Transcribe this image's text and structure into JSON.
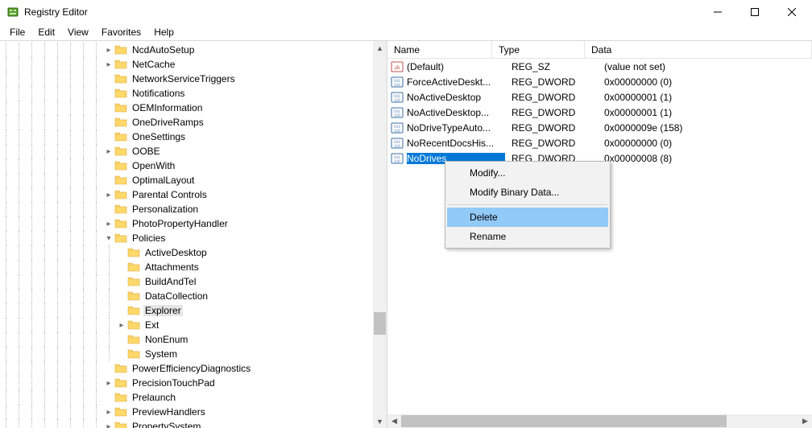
{
  "window": {
    "title": "Registry Editor"
  },
  "menubar": [
    "File",
    "Edit",
    "View",
    "Favorites",
    "Help"
  ],
  "tree": [
    {
      "depth": 8,
      "exp": "closed",
      "label": "NcdAutoSetup"
    },
    {
      "depth": 8,
      "exp": "closed",
      "label": "NetCache"
    },
    {
      "depth": 8,
      "exp": "none",
      "label": "NetworkServiceTriggers"
    },
    {
      "depth": 8,
      "exp": "none",
      "label": "Notifications"
    },
    {
      "depth": 8,
      "exp": "none",
      "label": "OEMInformation"
    },
    {
      "depth": 8,
      "exp": "none",
      "label": "OneDriveRamps"
    },
    {
      "depth": 8,
      "exp": "none",
      "label": "OneSettings"
    },
    {
      "depth": 8,
      "exp": "closed",
      "label": "OOBE"
    },
    {
      "depth": 8,
      "exp": "none",
      "label": "OpenWith"
    },
    {
      "depth": 8,
      "exp": "none",
      "label": "OptimalLayout"
    },
    {
      "depth": 8,
      "exp": "closed",
      "label": "Parental Controls"
    },
    {
      "depth": 8,
      "exp": "none",
      "label": "Personalization"
    },
    {
      "depth": 8,
      "exp": "closed",
      "label": "PhotoPropertyHandler"
    },
    {
      "depth": 8,
      "exp": "open",
      "label": "Policies"
    },
    {
      "depth": 9,
      "exp": "none",
      "label": "ActiveDesktop"
    },
    {
      "depth": 9,
      "exp": "none",
      "label": "Attachments"
    },
    {
      "depth": 9,
      "exp": "none",
      "label": "BuildAndTel"
    },
    {
      "depth": 9,
      "exp": "none",
      "label": "DataCollection"
    },
    {
      "depth": 9,
      "exp": "none",
      "label": "Explorer",
      "selected": true
    },
    {
      "depth": 9,
      "exp": "closed",
      "label": "Ext"
    },
    {
      "depth": 9,
      "exp": "none",
      "label": "NonEnum"
    },
    {
      "depth": 9,
      "exp": "none",
      "label": "System"
    },
    {
      "depth": 8,
      "exp": "none",
      "label": "PowerEfficiencyDiagnostics"
    },
    {
      "depth": 8,
      "exp": "closed",
      "label": "PrecisionTouchPad"
    },
    {
      "depth": 8,
      "exp": "none",
      "label": "Prelaunch"
    },
    {
      "depth": 8,
      "exp": "closed",
      "label": "PreviewHandlers"
    },
    {
      "depth": 8,
      "exp": "closed",
      "label": "PropertySystem"
    }
  ],
  "list": {
    "headers": {
      "name": "Name",
      "type": "Type",
      "data": "Data"
    },
    "rows": [
      {
        "icon": "sz",
        "name": "(Default)",
        "type": "REG_SZ",
        "data": "(value not set)"
      },
      {
        "icon": "dword",
        "name": "ForceActiveDeskt...",
        "type": "REG_DWORD",
        "data": "0x00000000 (0)"
      },
      {
        "icon": "dword",
        "name": "NoActiveDesktop",
        "type": "REG_DWORD",
        "data": "0x00000001 (1)"
      },
      {
        "icon": "dword",
        "name": "NoActiveDesktop...",
        "type": "REG_DWORD",
        "data": "0x00000001 (1)"
      },
      {
        "icon": "dword",
        "name": "NoDriveTypeAuto...",
        "type": "REG_DWORD",
        "data": "0x0000009e (158)"
      },
      {
        "icon": "dword",
        "name": "NoRecentDocsHis...",
        "type": "REG_DWORD",
        "data": "0x00000000 (0)"
      },
      {
        "icon": "dword",
        "name": "NoDrives",
        "type": "REG_DWORD",
        "data": "0x00000008 (8)",
        "selected": true
      }
    ]
  },
  "context_menu": {
    "items": [
      {
        "label": "Modify..."
      },
      {
        "label": "Modify Binary Data..."
      },
      {
        "sep": true
      },
      {
        "label": "Delete",
        "highlight": true
      },
      {
        "label": "Rename"
      }
    ]
  }
}
